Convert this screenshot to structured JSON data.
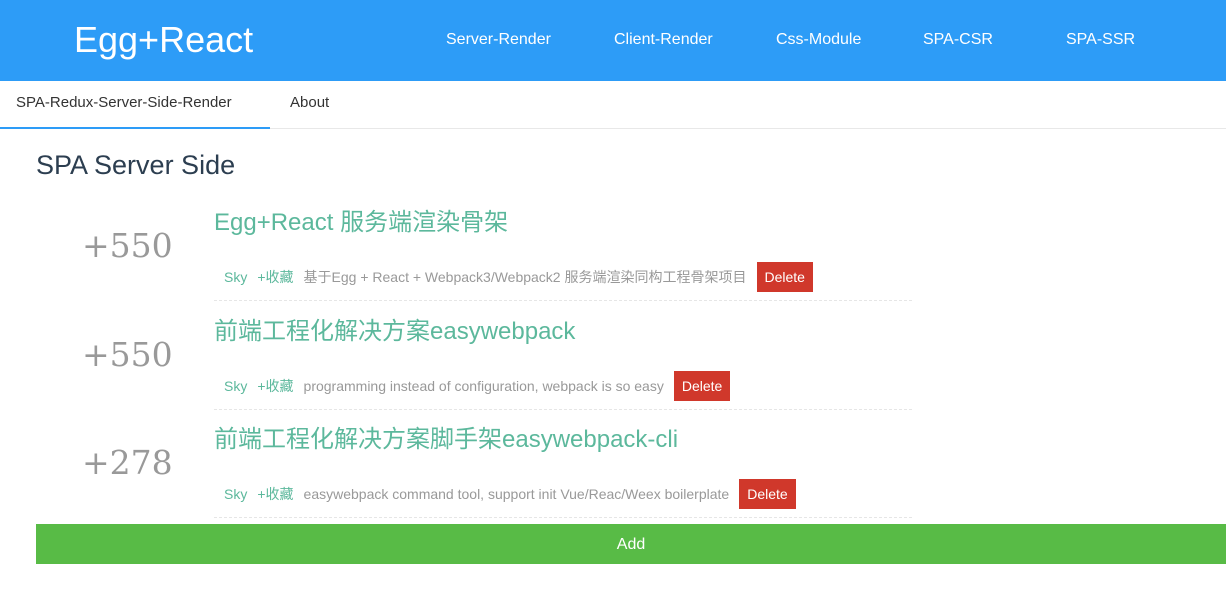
{
  "header": {
    "logo": "Egg+React",
    "nav": [
      {
        "label": "Server-Render"
      },
      {
        "label": "Client-Render"
      },
      {
        "label": "Css-Module"
      },
      {
        "label": "SPA-CSR"
      },
      {
        "label": "SPA-SSR"
      }
    ],
    "background_color": "#2d9cf7"
  },
  "tabs": [
    {
      "label": "SPA-Redux-Server-Side-Render",
      "active": true
    },
    {
      "label": "About",
      "active": false
    }
  ],
  "page_title": "SPA Server Side",
  "articles": [
    {
      "score": "+550",
      "title": "Egg+React 服务端渲染骨架",
      "author": "Sky",
      "favorite_label": "+收藏",
      "summary": "基于Egg + React + Webpack3/Webpack2 服务端渲染同构工程骨架项目",
      "delete_label": "Delete"
    },
    {
      "score": "+550",
      "title": "前端工程化解决方案easywebpack",
      "author": "Sky",
      "favorite_label": "+收藏",
      "summary": "programming instead of configuration, webpack is so easy",
      "delete_label": "Delete"
    },
    {
      "score": "+278",
      "title": "前端工程化解决方案脚手架easywebpack-cli",
      "author": "Sky",
      "favorite_label": "+收藏",
      "summary": "easywebpack command tool, support init Vue/Reac/Weex boilerplate",
      "delete_label": "Delete"
    }
  ],
  "add_button": {
    "label": "Add"
  },
  "colors": {
    "accent_green": "#5cb89c",
    "delete_red": "#d0382b",
    "add_green": "#58bb46"
  }
}
